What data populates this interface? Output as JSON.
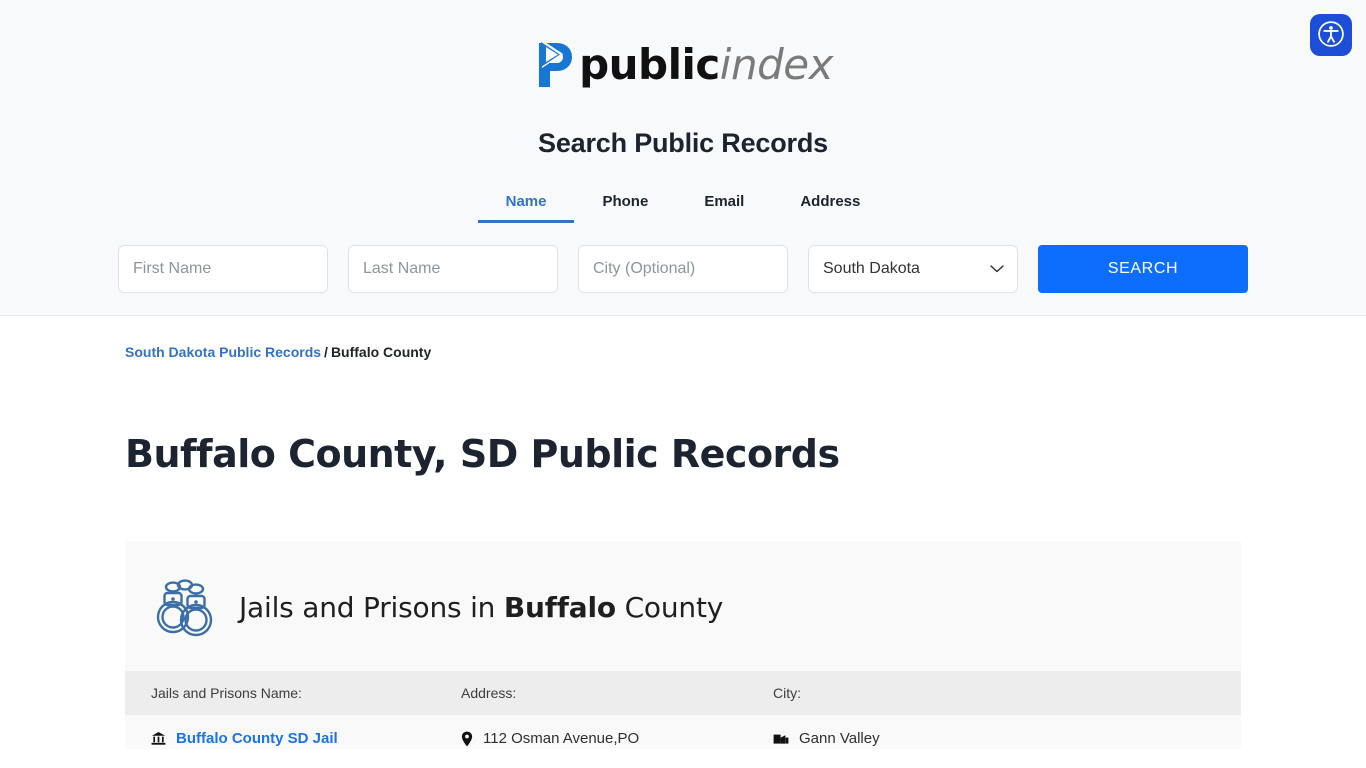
{
  "brand": {
    "logo_text_primary": "public",
    "logo_text_secondary": "index",
    "accent_blue": "#1a73e8",
    "logo_mark_color": "#1877d2"
  },
  "header": {
    "search_heading": "Search Public Records",
    "accessibility_label": "Accessibility",
    "tabs": [
      {
        "label": "Name",
        "active": true
      },
      {
        "label": "Phone",
        "active": false
      },
      {
        "label": "Email",
        "active": false
      },
      {
        "label": "Address",
        "active": false
      }
    ],
    "form": {
      "first_name_placeholder": "First Name",
      "first_name_value": "",
      "last_name_placeholder": "Last Name",
      "last_name_value": "",
      "city_placeholder": "City (Optional)",
      "city_value": "",
      "state_selected": "South Dakota",
      "state_options": [
        "South Dakota"
      ],
      "search_button_label": "SEARCH",
      "search_button_color": "#0d6efd"
    }
  },
  "breadcrumb": {
    "parent_label": "South Dakota Public Records",
    "separator": "/",
    "current_label": "Buffalo County"
  },
  "page": {
    "title": "Buffalo County, SD Public Records"
  },
  "card": {
    "icon": "handcuffs-icon",
    "title_prefix": "Jails and Prisons in ",
    "title_bold": "Buffalo",
    "title_suffix": " County",
    "columns": {
      "name": "Jails and Prisons Name:",
      "address": "Address:",
      "city": "City:"
    },
    "rows": [
      {
        "name": "Buffalo County SD Jail",
        "name_icon": "courthouse-icon",
        "address": "112 Osman Avenue,PO",
        "address_icon": "map-pin-icon",
        "city": "Gann Valley",
        "city_icon": "city-building-icon"
      }
    ]
  }
}
